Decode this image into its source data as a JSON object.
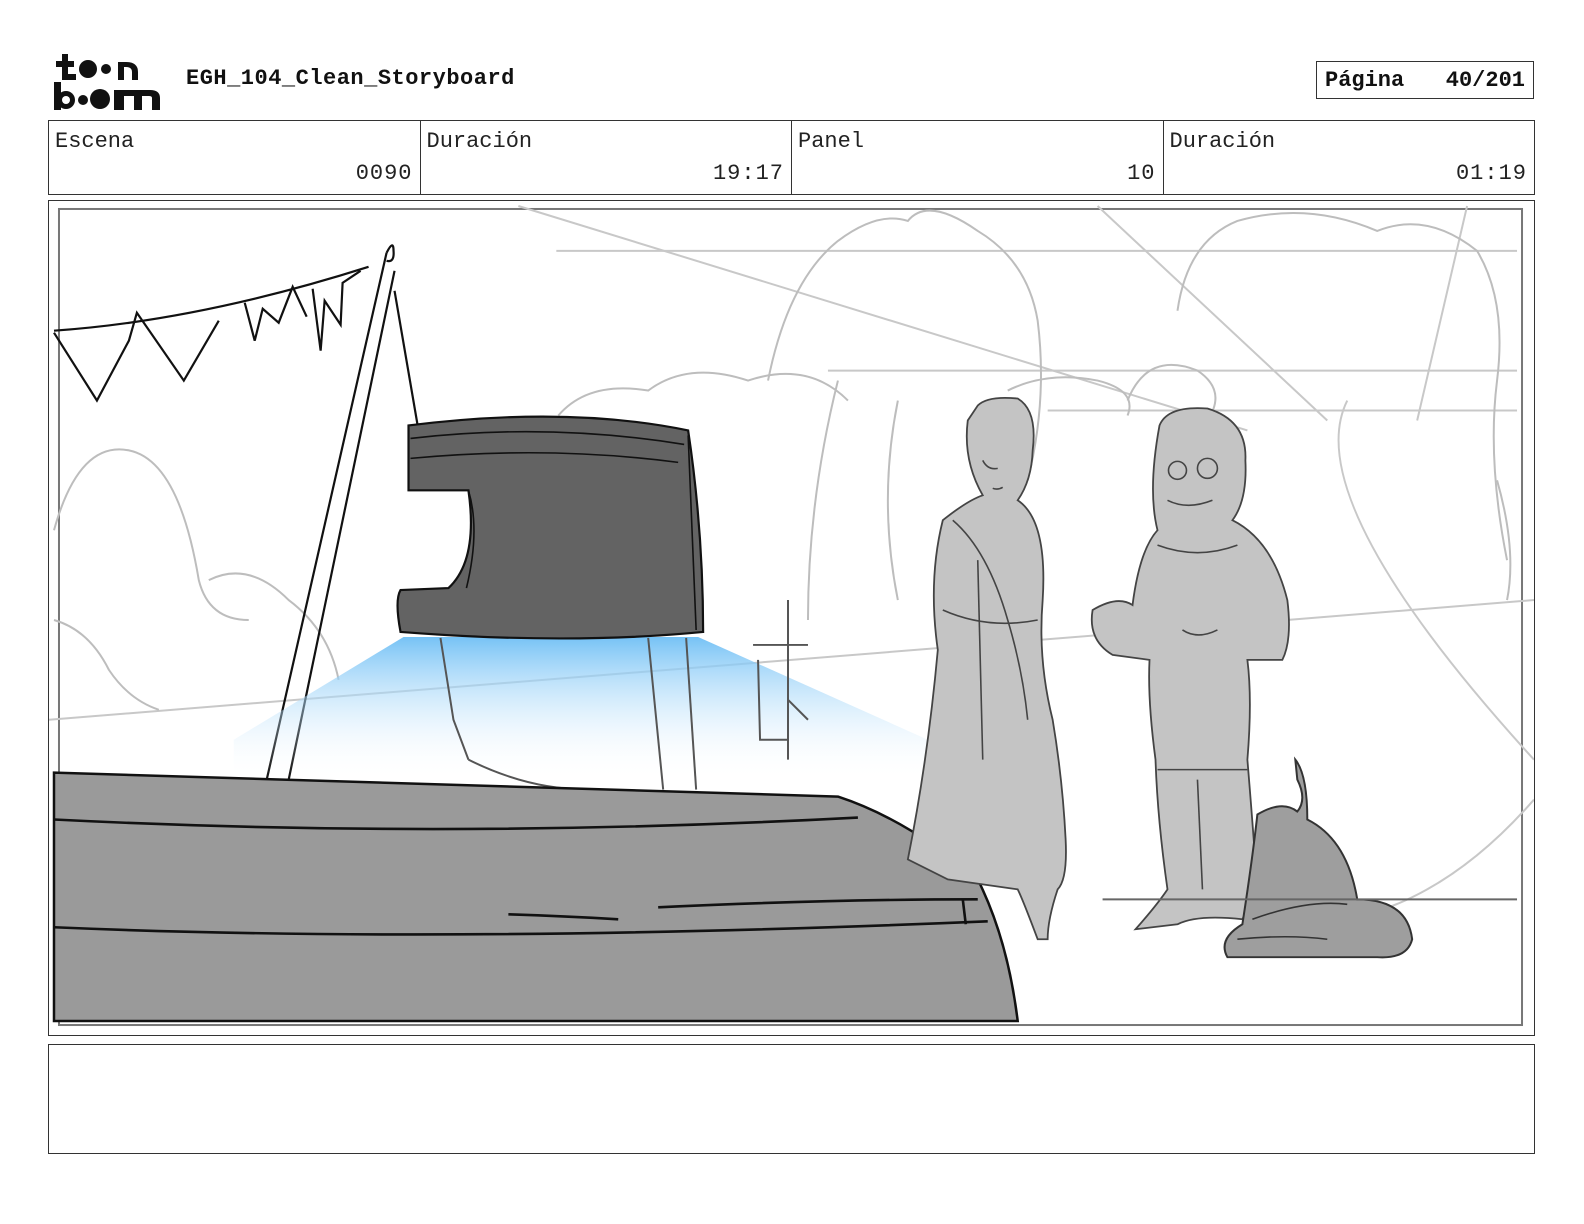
{
  "header": {
    "logo_label": "toon boom",
    "title": "EGH_104_Clean_Storyboard",
    "page_label": "Página",
    "page_value": "40/201"
  },
  "info": {
    "scene_label": "Escena",
    "scene_value": "0090",
    "scene_duration_label": "Duración",
    "scene_duration_value": "19:17",
    "panel_label": "Panel",
    "panel_value": "10",
    "panel_duration_label": "Duración",
    "panel_duration_value": "01:19"
  },
  "notes": {
    "text": ""
  },
  "colors": {
    "border": "#333333",
    "dark_object": "#636363",
    "foreground": "#9a9a9a",
    "characters": "#c4c4c4",
    "glow": "#7cc4f4"
  }
}
